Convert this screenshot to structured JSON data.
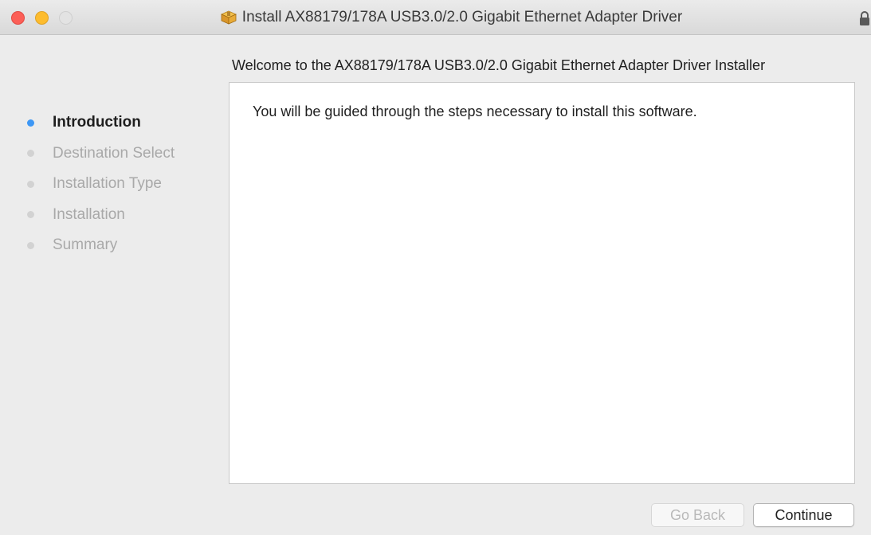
{
  "window": {
    "title": "Install AX88179/178A USB3.0/2.0 Gigabit Ethernet Adapter Driver",
    "title_icon": "package-icon",
    "lock_icon": "lock-icon"
  },
  "heading": "Welcome to the AX88179/178A USB3.0/2.0 Gigabit Ethernet Adapter Driver Installer",
  "steps": [
    {
      "label": "Introduction",
      "active": true
    },
    {
      "label": "Destination Select",
      "active": false
    },
    {
      "label": "Installation Type",
      "active": false
    },
    {
      "label": "Installation",
      "active": false
    },
    {
      "label": "Summary",
      "active": false
    }
  ],
  "content": {
    "text": "You will be guided through the steps necessary to install this software."
  },
  "buttons": {
    "go_back": "Go Back",
    "continue": "Continue"
  },
  "colors": {
    "active_step_dot": "#3d97f5",
    "close": "#fc5f57",
    "minimize": "#fdbc2e",
    "zoom": "#e3e3e3"
  }
}
